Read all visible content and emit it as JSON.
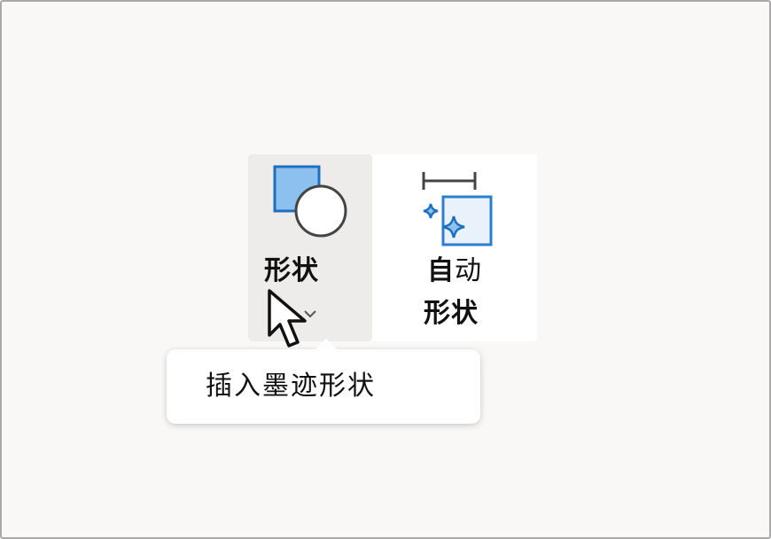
{
  "ribbon": {
    "shapes_button": {
      "label": "形状",
      "icon": "shapes-icon"
    },
    "auto_shapes_button": {
      "label_line1_bold": "自",
      "label_line1_regular": "动",
      "label_line2": "形状",
      "icon": "auto-shapes-icon"
    }
  },
  "tooltip": {
    "text": "插入墨迹形状"
  },
  "colors": {
    "accent_blue": "#2b7cd3",
    "accent_blue_light": "#8cc0ee",
    "hover_bg": "#edecea",
    "page_bg": "#f9f8f7"
  }
}
